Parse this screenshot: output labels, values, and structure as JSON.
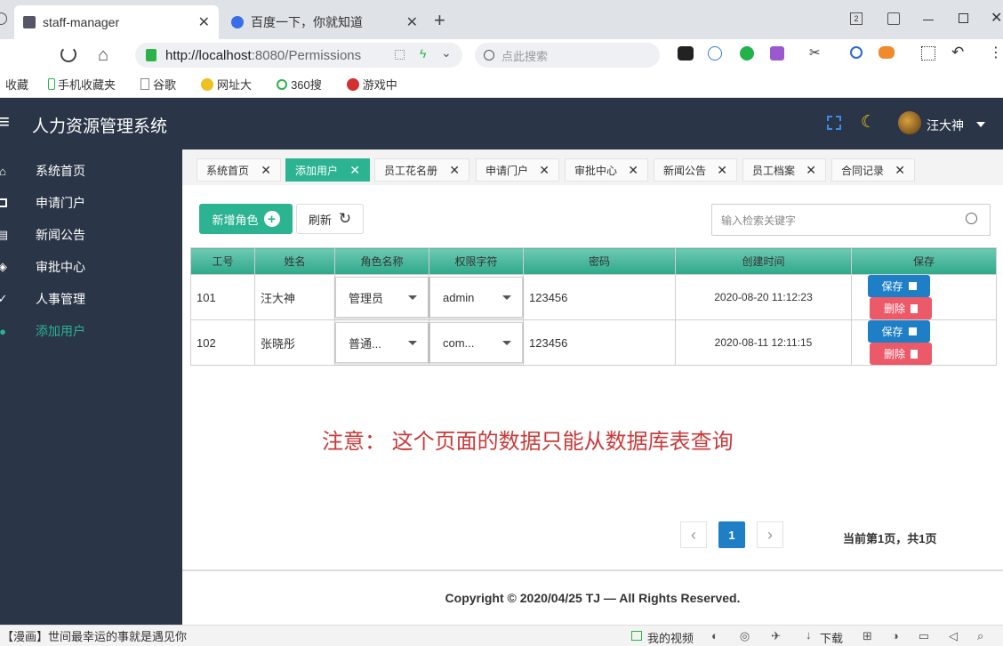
{
  "browser": {
    "tabs": [
      {
        "title": "staff-manager",
        "close": "✕"
      },
      {
        "title": "百度一下，你就知道",
        "close": "✕"
      }
    ],
    "new_tab": "+",
    "url_host": "http://localhost",
    "url_rest": ":8080/Permissions",
    "search_placeholder": "点此搜索",
    "bookmarks": [
      "收藏",
      "手机收藏夹",
      "谷歌",
      "网址大",
      "360搜",
      "游戏中"
    ]
  },
  "app": {
    "title": "人力资源管理系统",
    "menu_glyph": "≡",
    "user_name": "汪大神"
  },
  "sidebar": {
    "items": [
      {
        "label": "系统首页"
      },
      {
        "label": "申请门户"
      },
      {
        "label": "新闻公告"
      },
      {
        "label": "审批中心"
      },
      {
        "label": "人事管理"
      },
      {
        "label": "添加用户"
      }
    ]
  },
  "page_tabs": [
    "系统首页",
    "添加用户",
    "员工花名册",
    "申请门户",
    "审批中心",
    "新闻公告",
    "员工档案",
    "合同记录"
  ],
  "page_tab_close": "✕",
  "toolbar": {
    "add_label": "新增角色",
    "refresh_label": "刷新",
    "search_placeholder": "输入检索关键字"
  },
  "table": {
    "headers": [
      "工号",
      "姓名",
      "角色名称",
      "权限字符",
      "密码",
      "创建时间",
      "保存"
    ],
    "rows": [
      {
        "id": "101",
        "name": "汪大神",
        "role": "管理员",
        "perm": "admin",
        "password": "123456",
        "created": "2020-08-20 11:12:23"
      },
      {
        "id": "102",
        "name": "张晓彤",
        "role": "普通...",
        "perm": "com...",
        "password": "123456",
        "created": "2020-08-11 12:11:15"
      }
    ],
    "save_label": "保存",
    "delete_label": "删除"
  },
  "notice": "注意： 这个页面的数据只能从数据库表查询",
  "pagination": {
    "prev": "‹",
    "current": "1",
    "next": "›",
    "summary": "当前第1页，共1页"
  },
  "footer": "Copyright © 2020/04/25 TJ — All Rights Reserved.",
  "statusbar": {
    "left": "【漫画】世间最幸运的事就是遇见你",
    "video": "我的视频",
    "download": "下载"
  },
  "colors": {
    "accent": "#2bb392",
    "header": "#2a3547",
    "save": "#1e7fc7",
    "delete": "#ec5a6a",
    "notice": "#c83a3a"
  }
}
